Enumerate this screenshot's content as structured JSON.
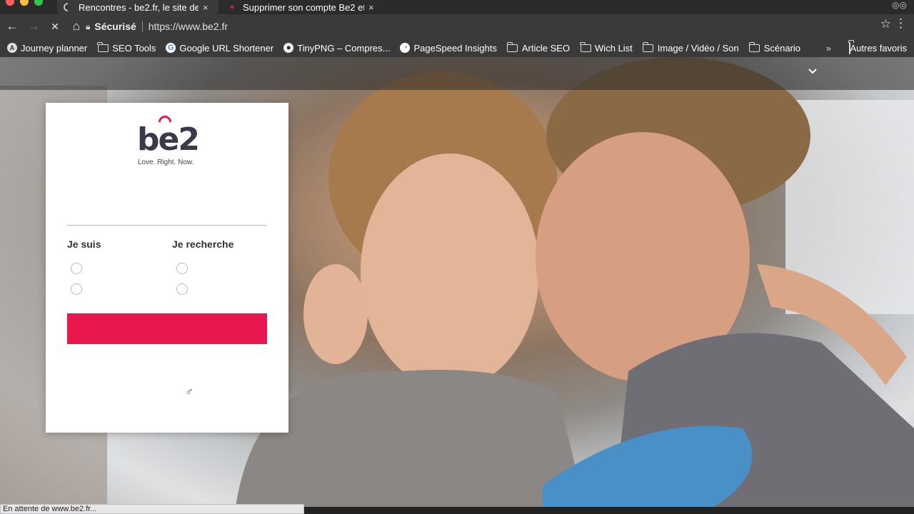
{
  "tabs": [
    {
      "title": "Rencontres - be2.fr, le site de",
      "active": true,
      "close": "×"
    },
    {
      "title": "Supprimer son compte Be2 et",
      "active": false,
      "close": "×"
    }
  ],
  "toolbar": {
    "back": "←",
    "forward": "→",
    "stop": "✕",
    "home": "⌂",
    "secure_label": "Sécurisé",
    "url": "https://www.be2.fr",
    "star": "☆",
    "menu": "⋮"
  },
  "bookmarks": [
    {
      "label": "Journey planner",
      "icon": "journey-icon"
    },
    {
      "label": "SEO Tools",
      "icon": "folder-icon"
    },
    {
      "label": "Google URL Shortener",
      "icon": "google-icon"
    },
    {
      "label": "TinyPNG – Compres...",
      "icon": "panda-icon"
    },
    {
      "label": "PageSpeed Insights",
      "icon": "pagespeed-icon"
    },
    {
      "label": "Article SEO",
      "icon": "folder-icon"
    },
    {
      "label": "Wich List",
      "icon": "folder-icon"
    },
    {
      "label": "Image / Vidéo / Son",
      "icon": "folder-icon"
    },
    {
      "label": "Scénario",
      "icon": "folder-icon"
    }
  ],
  "bookmarks_more": "»",
  "other_bookmarks": "Autres favoris",
  "card": {
    "logo": "be2",
    "tagline": "Love. Right. Now.",
    "i_am_label": "Je suis",
    "looking_for_label": "Je recherche",
    "cta_label": "",
    "gender_symbol": "♂",
    "cta_color": "#e8184f"
  },
  "page": {
    "chevron": "⌄"
  },
  "status": "En attente de www.be2.fr..."
}
